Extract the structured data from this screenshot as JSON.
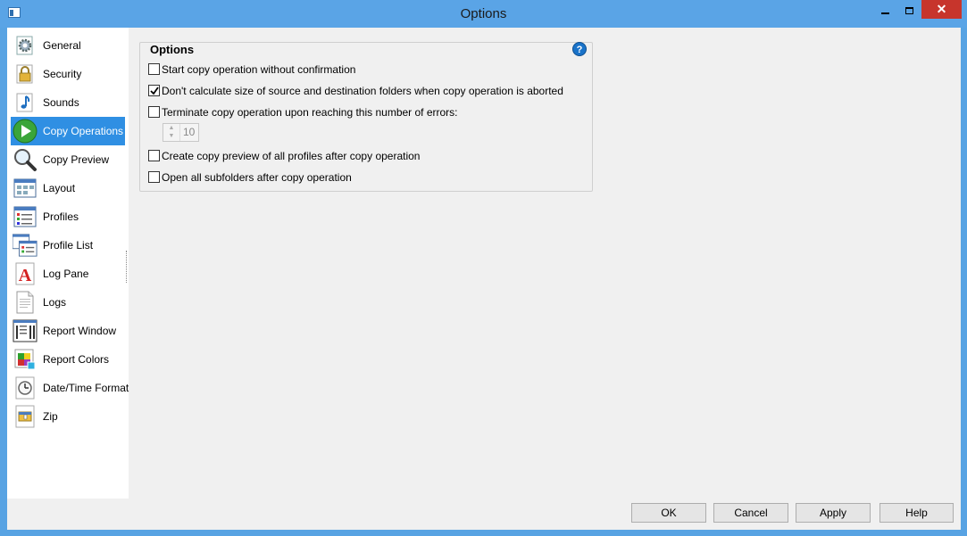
{
  "window": {
    "title": "Options"
  },
  "sidebar": {
    "items": [
      {
        "label": "General",
        "icon": "gear-icon"
      },
      {
        "label": "Security",
        "icon": "padlock-icon"
      },
      {
        "label": "Sounds",
        "icon": "music-note-icon"
      },
      {
        "label": "Copy Operations",
        "icon": "play-icon",
        "selected": true
      },
      {
        "label": "Copy Preview",
        "icon": "magnifier-icon"
      },
      {
        "label": "Layout",
        "icon": "layout-grid-icon"
      },
      {
        "label": "Profiles",
        "icon": "profiles-list-icon"
      },
      {
        "label": "Profile List",
        "icon": "profile-list-icon"
      },
      {
        "label": "Log Pane",
        "icon": "letter-a-icon"
      },
      {
        "label": "Logs",
        "icon": "document-icon"
      },
      {
        "label": "Report Window",
        "icon": "report-window-icon"
      },
      {
        "label": "Report Colors",
        "icon": "color-palette-icon"
      },
      {
        "label": "Date/Time Format",
        "icon": "clock-icon"
      },
      {
        "label": "Zip",
        "icon": "zip-archive-icon"
      }
    ]
  },
  "options": {
    "title": "Options",
    "help_icon": "?",
    "items": [
      {
        "label": "Start copy operation without confirmation",
        "checked": false
      },
      {
        "label": "Don't calculate size of source and destination folders when copy operation is aborted",
        "checked": true
      },
      {
        "label": "Terminate copy operation upon reaching this number of errors:",
        "checked": false
      },
      {
        "label": "Create copy preview of all profiles after copy operation",
        "checked": false
      },
      {
        "label": "Open all subfolders after copy operation",
        "checked": false
      }
    ],
    "error_limit": {
      "value": "10"
    }
  },
  "buttons": {
    "ok": "OK",
    "cancel": "Cancel",
    "apply": "Apply",
    "help": "Help"
  },
  "colors": {
    "titlebar": "#5aa4e6",
    "selected": "#2f8fe3",
    "close": "#c7352c"
  }
}
